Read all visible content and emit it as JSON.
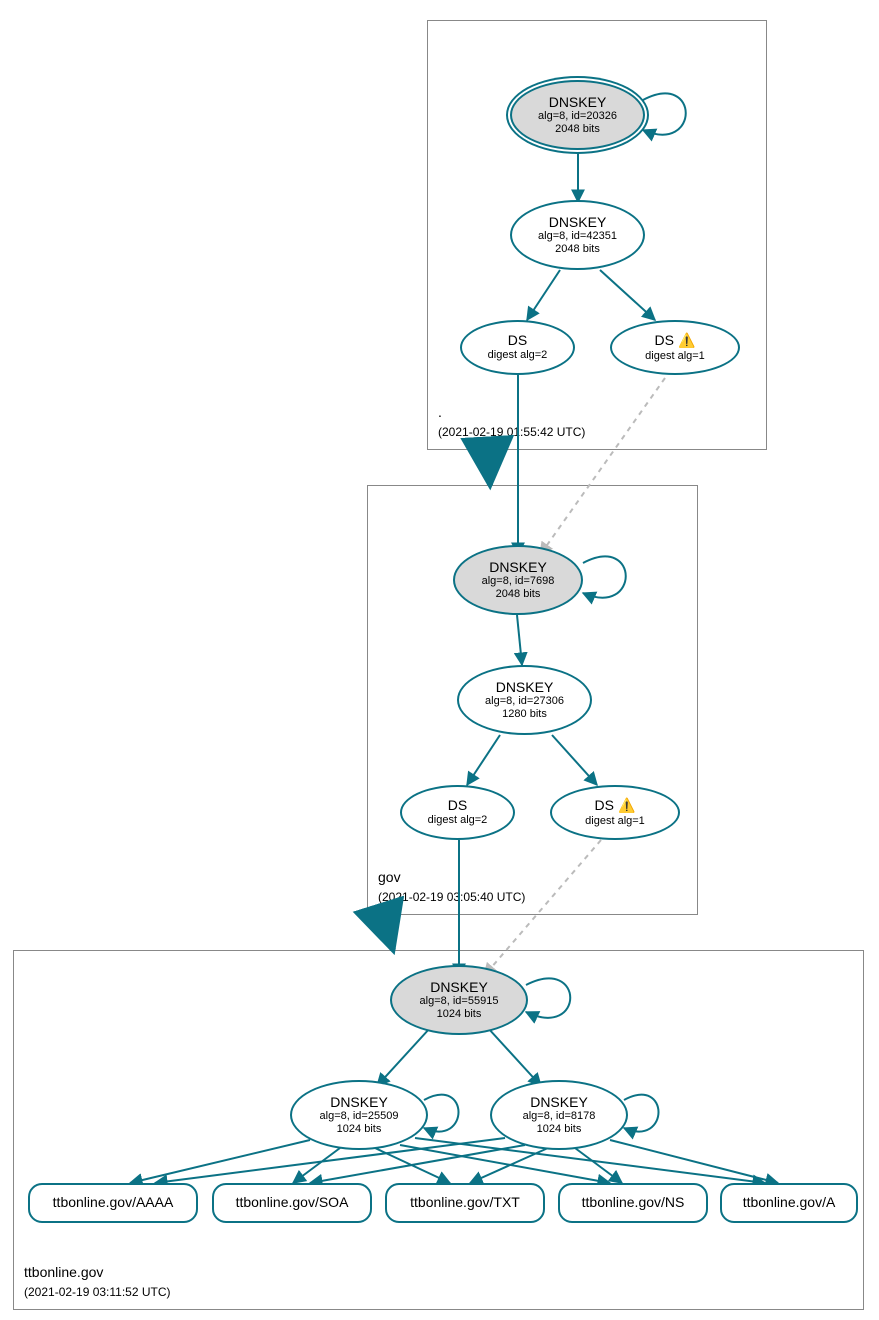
{
  "zones": {
    "root": {
      "name": ".",
      "timestamp": "(2021-02-19 01:55:42 UTC)"
    },
    "gov": {
      "name": "gov",
      "timestamp": "(2021-02-19 03:05:40 UTC)"
    },
    "ttb": {
      "name": "ttbonline.gov",
      "timestamp": "(2021-02-19 03:11:52 UTC)"
    }
  },
  "nodes": {
    "root_ksk": {
      "title": "DNSKEY",
      "line1": "alg=8, id=20326",
      "line2": "2048 bits"
    },
    "root_zsk": {
      "title": "DNSKEY",
      "line1": "alg=8, id=42351",
      "line2": "2048 bits"
    },
    "root_ds2": {
      "title": "DS",
      "line1": "digest alg=2"
    },
    "root_ds1": {
      "title": "DS",
      "line1": "digest alg=1",
      "warn": "⚠️"
    },
    "gov_ksk": {
      "title": "DNSKEY",
      "line1": "alg=8, id=7698",
      "line2": "2048 bits"
    },
    "gov_zsk": {
      "title": "DNSKEY",
      "line1": "alg=8, id=27306",
      "line2": "1280 bits"
    },
    "gov_ds2": {
      "title": "DS",
      "line1": "digest alg=2"
    },
    "gov_ds1": {
      "title": "DS",
      "line1": "digest alg=1",
      "warn": "⚠️"
    },
    "ttb_ksk": {
      "title": "DNSKEY",
      "line1": "alg=8, id=55915",
      "line2": "1024 bits"
    },
    "ttb_zsk1": {
      "title": "DNSKEY",
      "line1": "alg=8, id=25509",
      "line2": "1024 bits"
    },
    "ttb_zsk2": {
      "title": "DNSKEY",
      "line1": "alg=8, id=8178",
      "line2": "1024 bits"
    },
    "rr_aaaa": {
      "label": "ttbonline.gov/AAAA"
    },
    "rr_soa": {
      "label": "ttbonline.gov/SOA"
    },
    "rr_txt": {
      "label": "ttbonline.gov/TXT"
    },
    "rr_ns": {
      "label": "ttbonline.gov/NS"
    },
    "rr_a": {
      "label": "ttbonline.gov/A"
    }
  }
}
